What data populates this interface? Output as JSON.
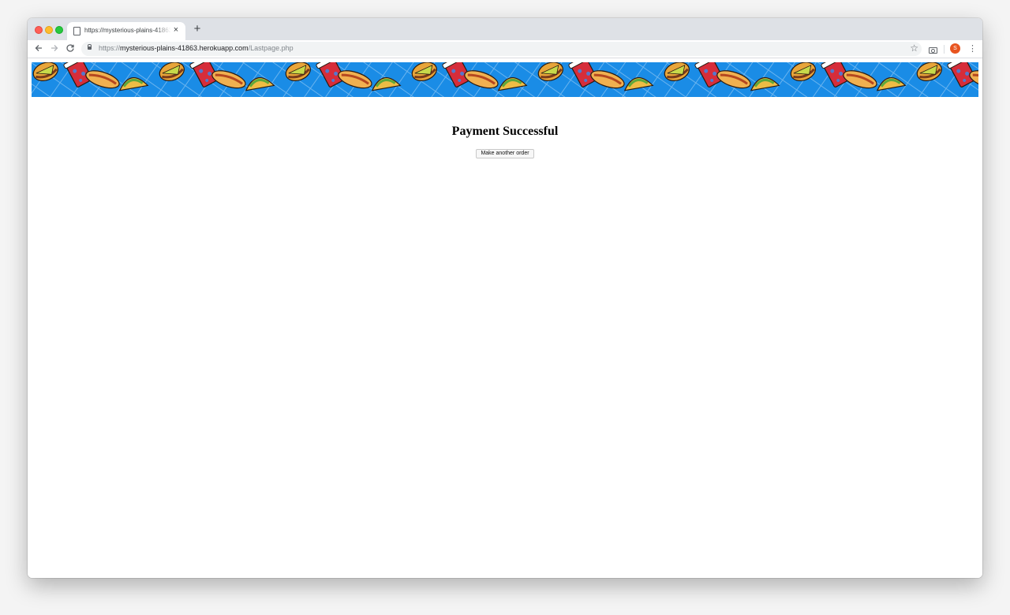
{
  "browser": {
    "tab_title": "https://mysterious-plains-41863.herokuapp.com/Lastpage.php",
    "new_tab_symbol": "+",
    "tab_close_symbol": "×",
    "url_prefix": "https://",
    "url_host": "mysterious-plains-41863.herokuapp.com",
    "url_path": "/Lastpage.php",
    "profile_initial": "S",
    "icons": {
      "back": "arrow-left-icon",
      "forward": "arrow-right-icon",
      "reload": "reload-icon",
      "lock": "lock-icon",
      "bookmark": "star-icon",
      "screenshot": "camera-icon",
      "menu": "kebab-menu-icon",
      "page": "document-icon"
    },
    "colors": {
      "tabstrip": "#dee1e6",
      "omnibox": "#f1f3f4",
      "avatar": "#e8541f"
    }
  },
  "page": {
    "banner": {
      "description_icon": "food-pattern-banner",
      "background": "#1a8ce6"
    },
    "heading": "Payment Successful",
    "button_label": "Make another order"
  }
}
